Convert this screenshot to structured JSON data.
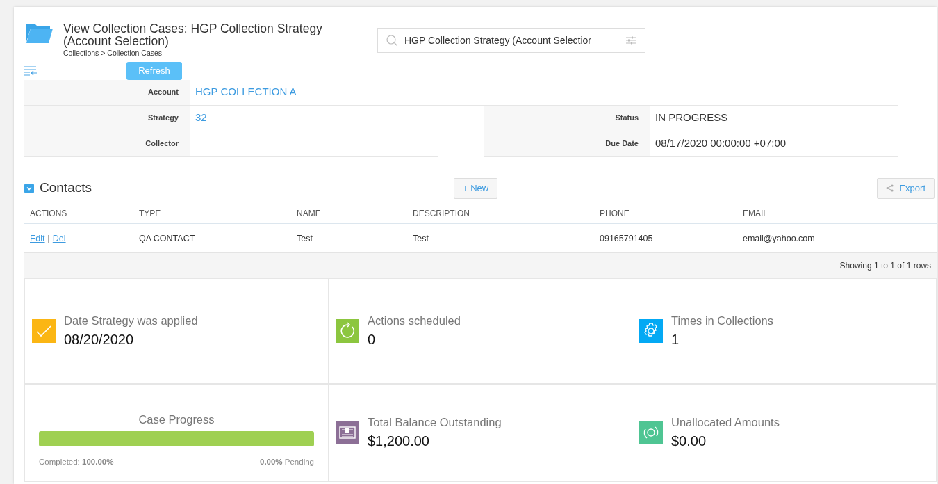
{
  "header": {
    "title": "View Collection Cases: HGP Collection Strategy (Account Selection)",
    "breadcrumb": "Collections > Collection Cases"
  },
  "search": {
    "value": "HGP Collection Strategy (Account Selectior"
  },
  "refresh_button": "Refresh",
  "account": {
    "label": "Account",
    "value": "HGP COLLECTION A",
    "link": true
  },
  "left_fields": [
    {
      "label": "Strategy",
      "value": "32",
      "link": true
    },
    {
      "label": "Collector"
    }
  ],
  "right_fields": [
    {
      "label": "Status",
      "value": "IN PROGRESS",
      "link": false
    },
    {
      "label": "Due Date",
      "value": "08/17/2020 00:00:00 +07:00",
      "link": false
    }
  ],
  "contacts": {
    "title": "Contacts",
    "expanded": true,
    "new_button": "+ New",
    "export_button": "Export",
    "action_column": "ACTIONS",
    "columns": [
      "TYPE",
      "NAME",
      "DESCRIPTION",
      "PHONE",
      "EMAIL"
    ],
    "rows": [
      {
        "actions": [
          "Edit",
          "|",
          "Del"
        ],
        "cells": [
          "QA CONTACT",
          "Test",
          "Test",
          "09165791405",
          "email@yahoo.com"
        ]
      }
    ],
    "footer": "Showing 1 to 1 of 1 rows"
  },
  "tiles": [
    {
      "kind": "stat",
      "label": "Date Strategy was applied",
      "value": "08/20/2020",
      "color": "#fbb614"
    },
    {
      "kind": "stat",
      "label": "Actions scheduled",
      "value": "0",
      "color": "#8cc63f"
    },
    {
      "kind": "stat",
      "label": "Times in Collections",
      "value": "1",
      "color": "#03a9f4"
    },
    {
      "kind": "progress",
      "label": "Case Progress",
      "level": 1,
      "completed": "Completed: **100.00%**",
      "pending": "**0.00%** Pending"
    },
    {
      "kind": "stat",
      "label": "Total Balance Outstanding",
      "value": "$1,200.00",
      "color": "#8c6f96"
    },
    {
      "kind": "stat",
      "label": "Unallocated Amounts",
      "value": "$0.00",
      "color": "#4fc593"
    }
  ]
}
